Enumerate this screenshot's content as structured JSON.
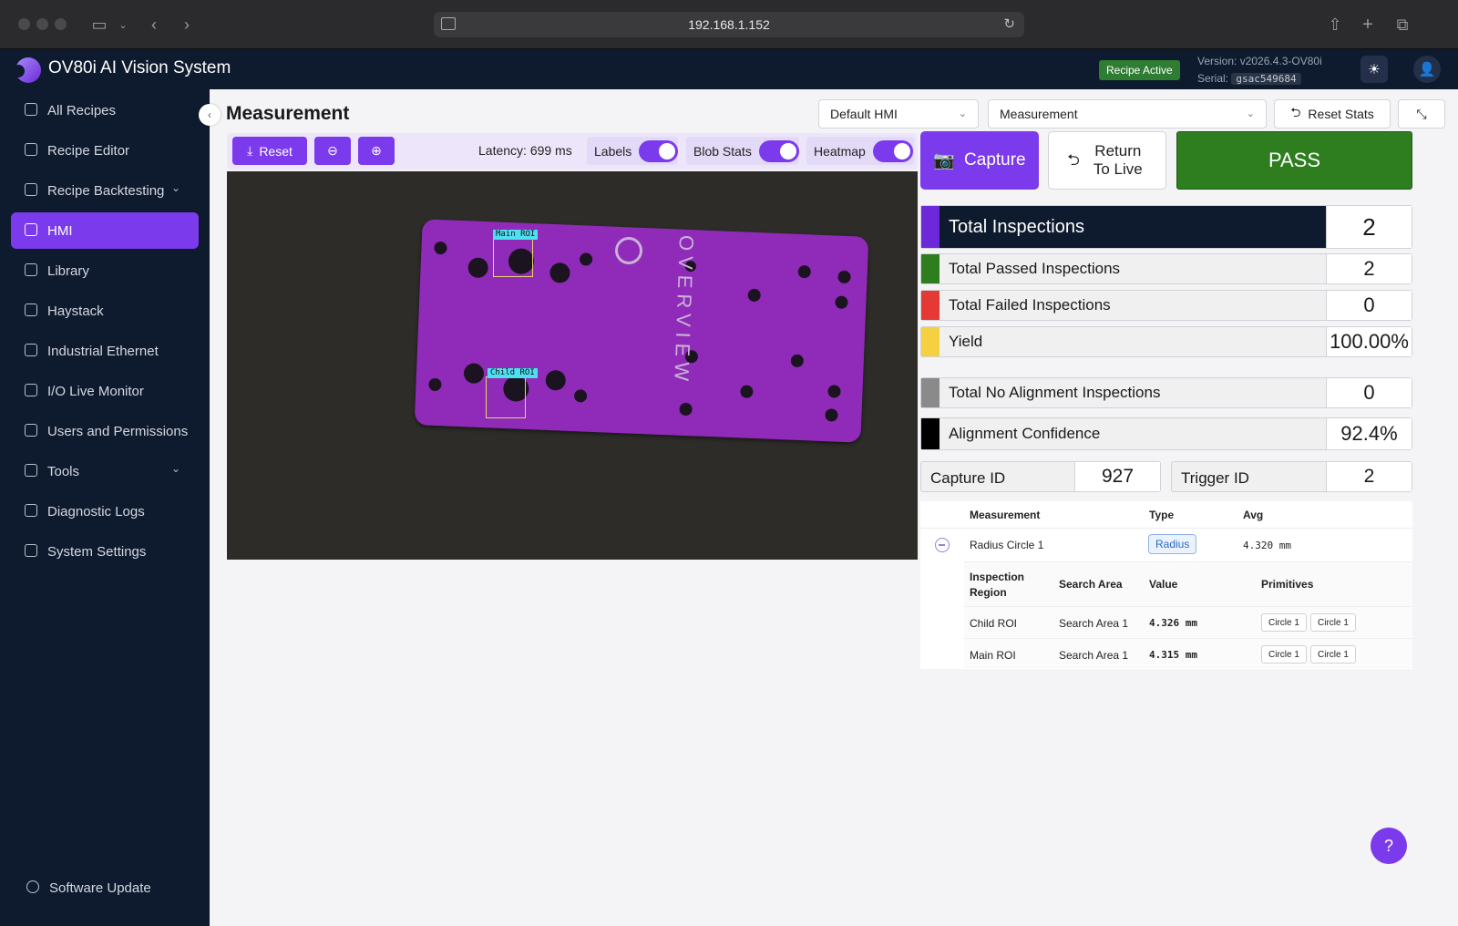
{
  "browser": {
    "url": "192.168.1.152"
  },
  "app": {
    "title": "OV80i AI Vision System",
    "recipe_status": "Recipe Active",
    "version_label": "Version: v2026.4.3-OV80i",
    "serial_label": "Serial:",
    "serial": "gsac549684"
  },
  "sidebar": {
    "items": [
      {
        "label": "All Recipes"
      },
      {
        "label": "Recipe Editor"
      },
      {
        "label": "Recipe Backtesting"
      },
      {
        "label": "HMI"
      },
      {
        "label": "Library"
      },
      {
        "label": "Haystack"
      },
      {
        "label": "Industrial Ethernet"
      },
      {
        "label": "I/O Live Monitor"
      },
      {
        "label": "Users and Permissions"
      },
      {
        "label": "Tools"
      },
      {
        "label": "Diagnostic Logs"
      },
      {
        "label": "System Settings"
      }
    ],
    "footer": "Software Update"
  },
  "main": {
    "title": "Measurement",
    "hmi_select": "Default HMI",
    "view_select": "Measurement",
    "reset_stats": "Reset Stats"
  },
  "viewer": {
    "reset": "Reset",
    "latency": "Latency: 699 ms",
    "toggles": {
      "labels": "Labels",
      "blob_stats": "Blob Stats",
      "heatmap": "Heatmap"
    },
    "overlay": {
      "main_roi": "Main ROI",
      "child_roi": "Child ROI",
      "plate_text": "OVERVIEW"
    }
  },
  "actions": {
    "capture": "Capture",
    "return_to_live": "Return To Live",
    "result": "PASS"
  },
  "stats": {
    "total_inspections": {
      "label": "Total Inspections",
      "value": "2",
      "color": "#6d28d9"
    },
    "passed": {
      "label": "Total Passed Inspections",
      "value": "2",
      "color": "#2e7d1f"
    },
    "failed": {
      "label": "Total Failed Inspections",
      "value": "0",
      "color": "#e53935"
    },
    "yield": {
      "label": "Yield",
      "value": "100.00%",
      "color": "#f5d142"
    },
    "no_alignment": {
      "label": "Total No Alignment Inspections",
      "value": "0",
      "color": "#8a8a8a"
    },
    "alignment_conf": {
      "label": "Alignment Confidence",
      "value": "92.4%",
      "color": "#000000"
    },
    "capture_id": {
      "label": "Capture ID",
      "value": "927"
    },
    "trigger_id": {
      "label": "Trigger ID",
      "value": "2"
    }
  },
  "measurements": {
    "headers": {
      "measurement": "Measurement",
      "type": "Type",
      "avg": "Avg"
    },
    "row": {
      "name": "Radius Circle 1",
      "type": "Radius",
      "avg": "4.320 mm"
    },
    "sub_headers": {
      "region": "Inspection Region",
      "search_area": "Search Area",
      "value": "Value",
      "primitives": "Primitives"
    },
    "sub_rows": [
      {
        "region": "Child ROI",
        "search_area": "Search Area 1",
        "value": "4.326 mm",
        "prim1": "Circle 1",
        "prim2": "Circle 1"
      },
      {
        "region": "Main ROI",
        "search_area": "Search Area 1",
        "value": "4.315 mm",
        "prim1": "Circle 1",
        "prim2": "Circle 1"
      }
    ]
  }
}
